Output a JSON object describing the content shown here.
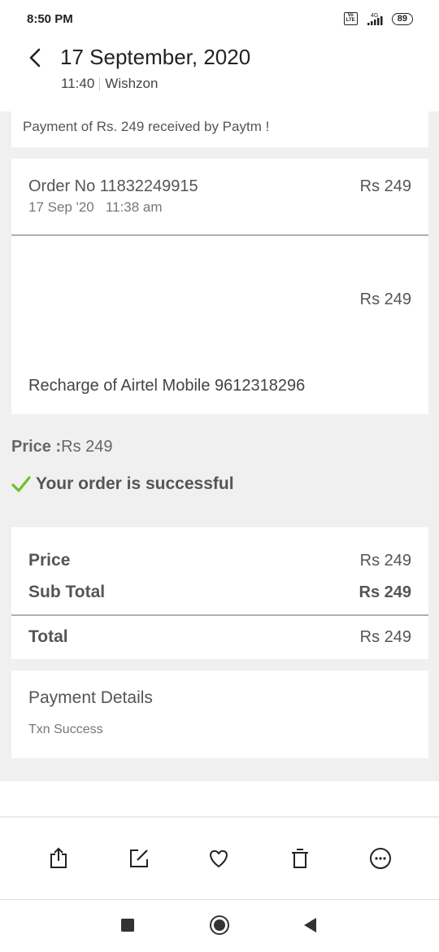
{
  "status_bar": {
    "time": "8:50 PM",
    "network": "4G",
    "volte": "Vo LTE",
    "battery": "89"
  },
  "header": {
    "title": "17 September, 2020",
    "time": "11:40",
    "sender": "Wishzon"
  },
  "notice": {
    "text": "Payment of Rs. 249 received by Paytm !"
  },
  "order": {
    "number_text": "Order No 11832249915",
    "date_text": "17 Sep '20   11:38 am",
    "amount": "Rs 249",
    "item_amount": "Rs 249",
    "item_description": "Recharge of Airtel Mobile 9612318296"
  },
  "price_line": {
    "label": "Price :",
    "value": "Rs 249"
  },
  "success": {
    "text": "Your order is successful"
  },
  "summary": {
    "rows": [
      {
        "label": "Price",
        "value": "Rs 249"
      },
      {
        "label": "Sub Total",
        "value": "Rs 249"
      },
      {
        "label": "Total",
        "value": "Rs 249"
      }
    ]
  },
  "payment": {
    "title": "Payment Details",
    "status": "Txn Success"
  },
  "toolbar": {
    "icons": [
      "share-icon",
      "edit-icon",
      "favorite-icon",
      "delete-icon",
      "more-icon"
    ]
  },
  "navbar": {
    "icons": [
      "recents-icon",
      "home-icon",
      "back-nav-icon"
    ]
  },
  "colors": {
    "success_check": "#6fbf2a",
    "background": "#f0f0f0"
  }
}
